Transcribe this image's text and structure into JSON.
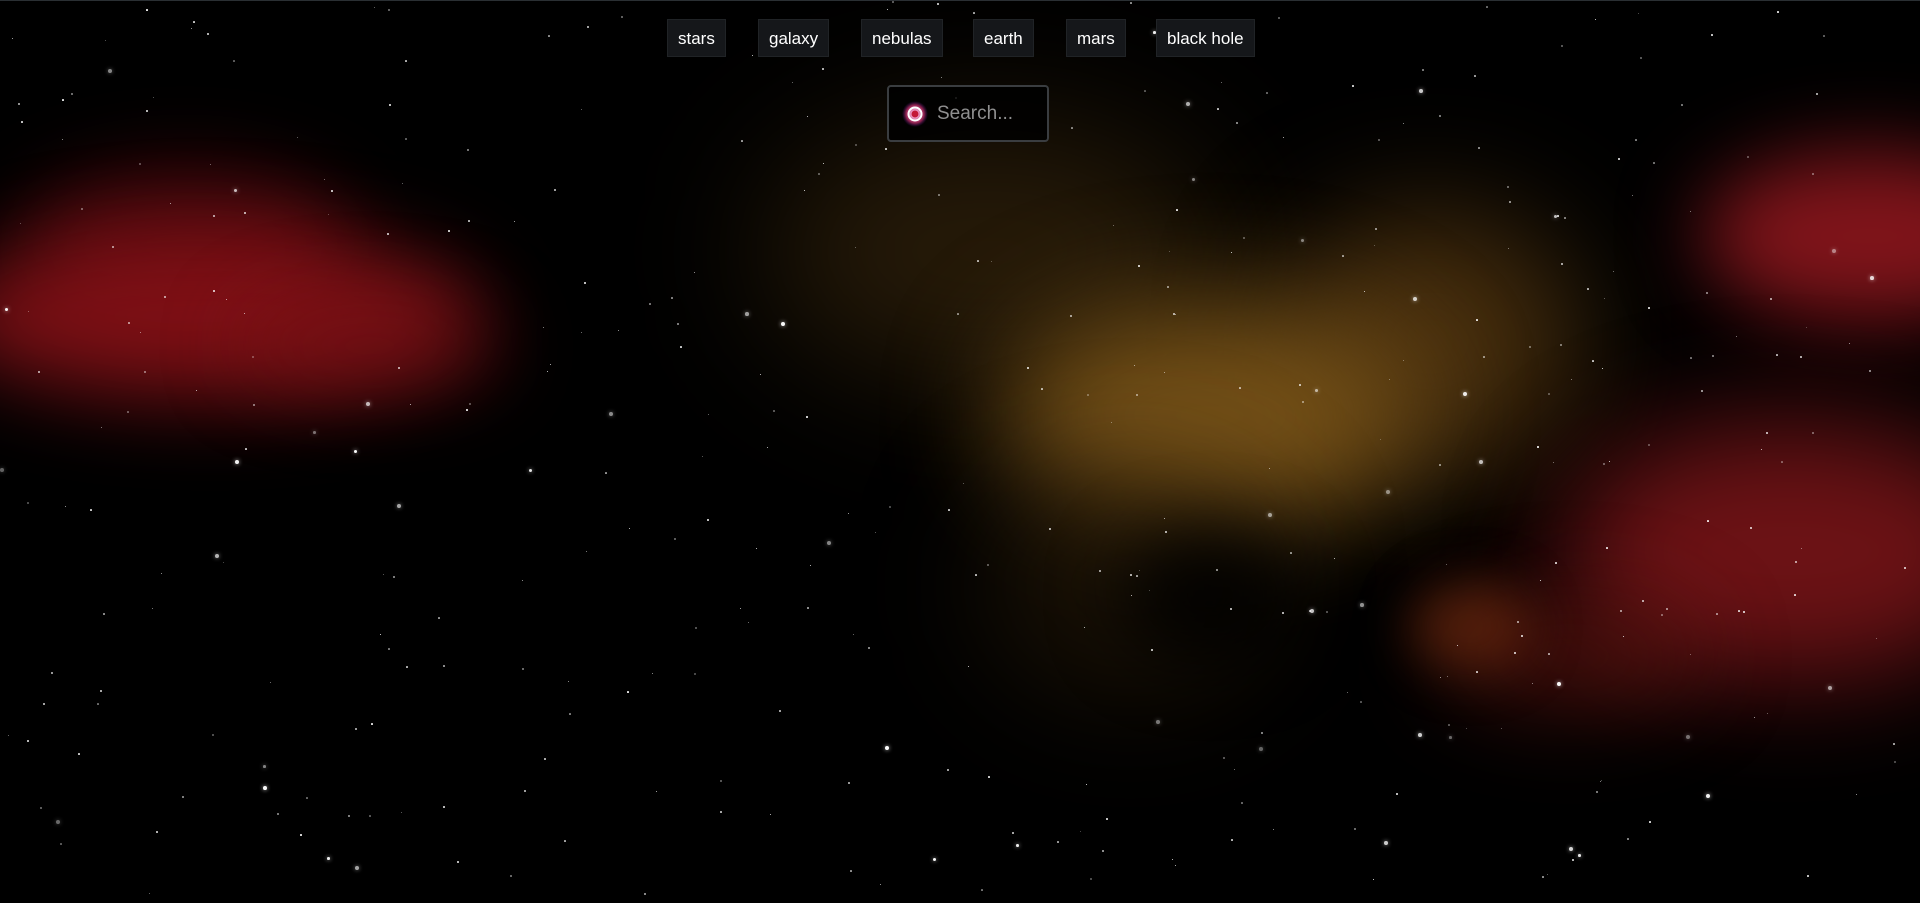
{
  "nav": {
    "items": [
      {
        "label": "stars"
      },
      {
        "label": "galaxy"
      },
      {
        "label": "nebulas"
      },
      {
        "label": "earth"
      },
      {
        "label": "mars"
      },
      {
        "label": "black hole"
      }
    ]
  },
  "search": {
    "placeholder": "Search...",
    "value": "",
    "icon": "glowing-orb-icon"
  },
  "colors": {
    "background": "#000000",
    "nebula_red": "#8c1218",
    "nebula_gold": "#7a5418",
    "button_bg": "#15171a",
    "button_text": "#ffffff",
    "search_border": "#3a3d40",
    "icon_glow": "#ff3c8c"
  }
}
